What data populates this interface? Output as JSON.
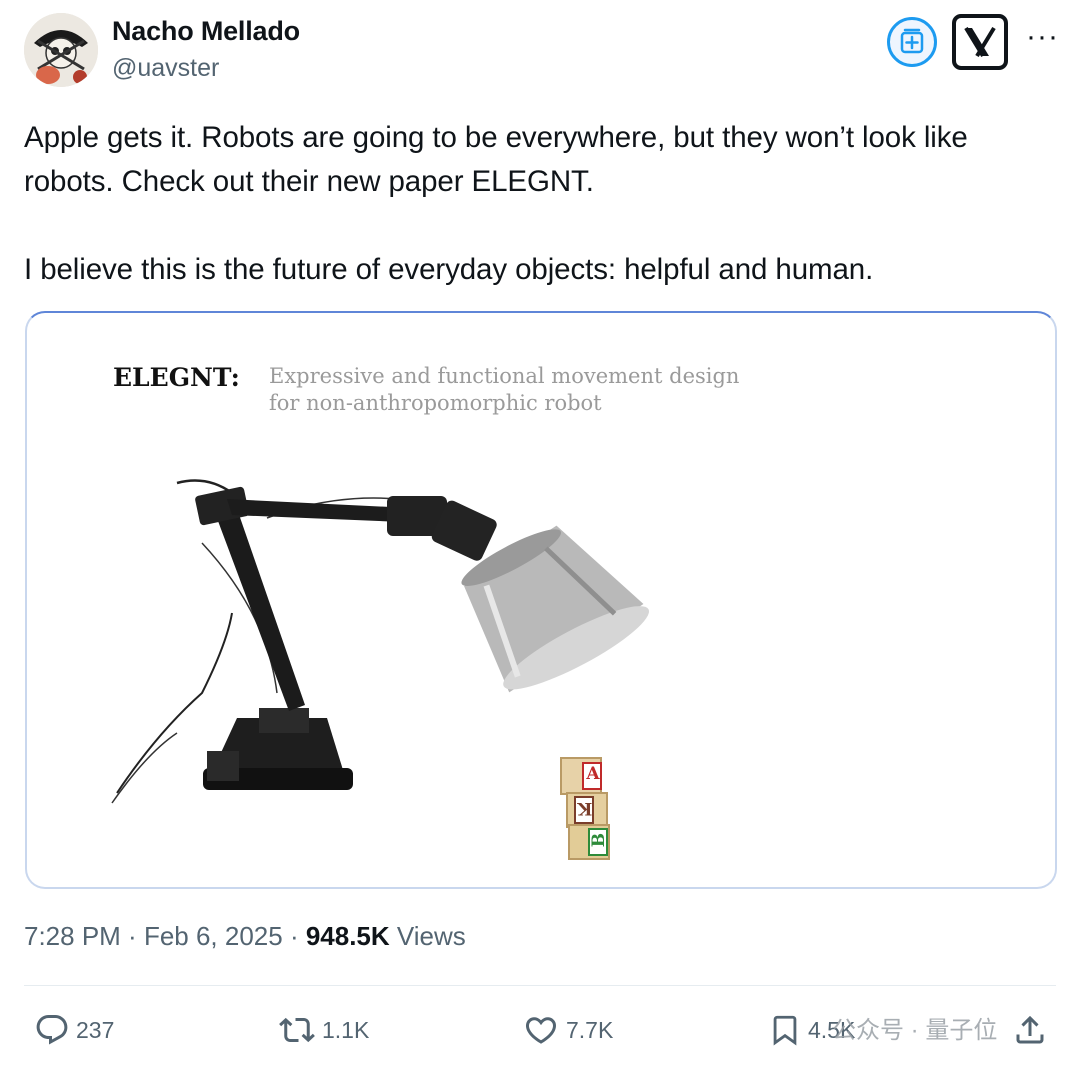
{
  "author": {
    "name": "Nacho Mellado",
    "handle": "@uavster"
  },
  "icons": {
    "grok": "grok-icon",
    "x_logo": "x-logo-icon",
    "more": "more-icon"
  },
  "tweet": {
    "paragraph1": "Apple gets it. Robots are going to be everywhere, but they won’t look like robots. Check out their new paper ELEGNT.",
    "paragraph2": "I believe this is the future of everyday objects: helpful and human."
  },
  "media": {
    "title": "ELEGNT:",
    "subtitle_line1": "Expressive and functional movement design",
    "subtitle_line2": "for  non-anthropomorphic robot",
    "blocks": [
      "A",
      "K",
      "B"
    ]
  },
  "meta": {
    "time": "7:28 PM",
    "sep1": " · ",
    "date": "Feb 6, 2025",
    "sep2": " · ",
    "views_count": "948.5K",
    "views_label": " Views"
  },
  "actions": {
    "replies": "237",
    "reposts": "1.1K",
    "likes": "7.7K",
    "bookmarks": "4.5K"
  },
  "watermark": "公众号 · 量子位",
  "colors": {
    "text": "#0f1419",
    "secondary": "#536471",
    "accent": "#1d9bf0"
  }
}
